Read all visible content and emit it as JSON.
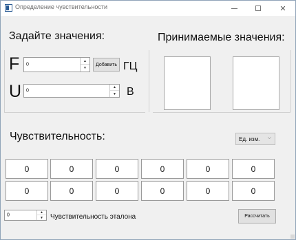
{
  "window": {
    "title": "Определение чувствительности"
  },
  "left_section": {
    "heading": "Задайте значения:",
    "f_letter": "F",
    "f_value": "0",
    "add_button": "Добавить",
    "f_unit": "ГЦ",
    "u_letter": "U",
    "u_value": "0",
    "u_unit": "В"
  },
  "right_section": {
    "heading": "Принимаемые значения:"
  },
  "sensitivity": {
    "heading": "Чувствительность:",
    "units_combo": "Ед. изм.",
    "row1": [
      "0",
      "0",
      "0",
      "0",
      "0",
      "0"
    ],
    "row2": [
      "0",
      "0",
      "0",
      "0",
      "0",
      "0"
    ]
  },
  "bottom": {
    "etalon_value": "0",
    "etalon_label": "Чувствительность эталона",
    "calc_button": "Рассчитать"
  }
}
